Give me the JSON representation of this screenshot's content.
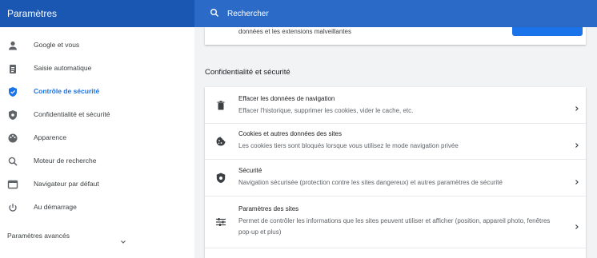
{
  "header": {
    "app_title": "Paramètres",
    "search_placeholder": "Rechercher"
  },
  "colors": {
    "header_bg": "#1a57b3",
    "search_bg": "#2b6bc7",
    "accent": "#1a73e8"
  },
  "sidebar": {
    "items": [
      {
        "label": "Google et vous",
        "icon": "person-icon",
        "active": false
      },
      {
        "label": "Saisie automatique",
        "icon": "clipboard-icon",
        "active": false
      },
      {
        "label": "Contrôle de sécurité",
        "icon": "shield-check-icon",
        "active": true
      },
      {
        "label": "Confidentialité et sécurité",
        "icon": "shield-icon",
        "active": false
      },
      {
        "label": "Apparence",
        "icon": "palette-icon",
        "active": false
      },
      {
        "label": "Moteur de recherche",
        "icon": "search-icon",
        "active": false
      },
      {
        "label": "Navigateur par défaut",
        "icon": "browser-icon",
        "active": false
      },
      {
        "label": "Au démarrage",
        "icon": "power-icon",
        "active": false
      }
    ],
    "advanced_label": "Paramètres avancés"
  },
  "main": {
    "top_card_text": "données et les extensions malveillantes",
    "section_title": "Confidentialité et sécurité",
    "rows": [
      {
        "title": "Effacer les données de navigation",
        "desc": "Effacer l'historique, supprimer les cookies, vider le cache, etc.",
        "icon": "trash-icon"
      },
      {
        "title": "Cookies et autres données des sites",
        "desc": "Les cookies tiers sont bloqués lorsque vous utilisez le mode navigation privée",
        "icon": "cookie-icon"
      },
      {
        "title": "Sécurité",
        "desc": "Navigation sécurisée (protection contre les sites dangereux) et autres paramètres de sécurité",
        "icon": "shield-icon"
      },
      {
        "title": "Paramètres des sites",
        "desc": "Permet de contrôler les informations que les sites peuvent utiliser et afficher (position, appareil photo, fenêtres pop-up et plus)",
        "icon": "sliders-icon"
      }
    ]
  }
}
